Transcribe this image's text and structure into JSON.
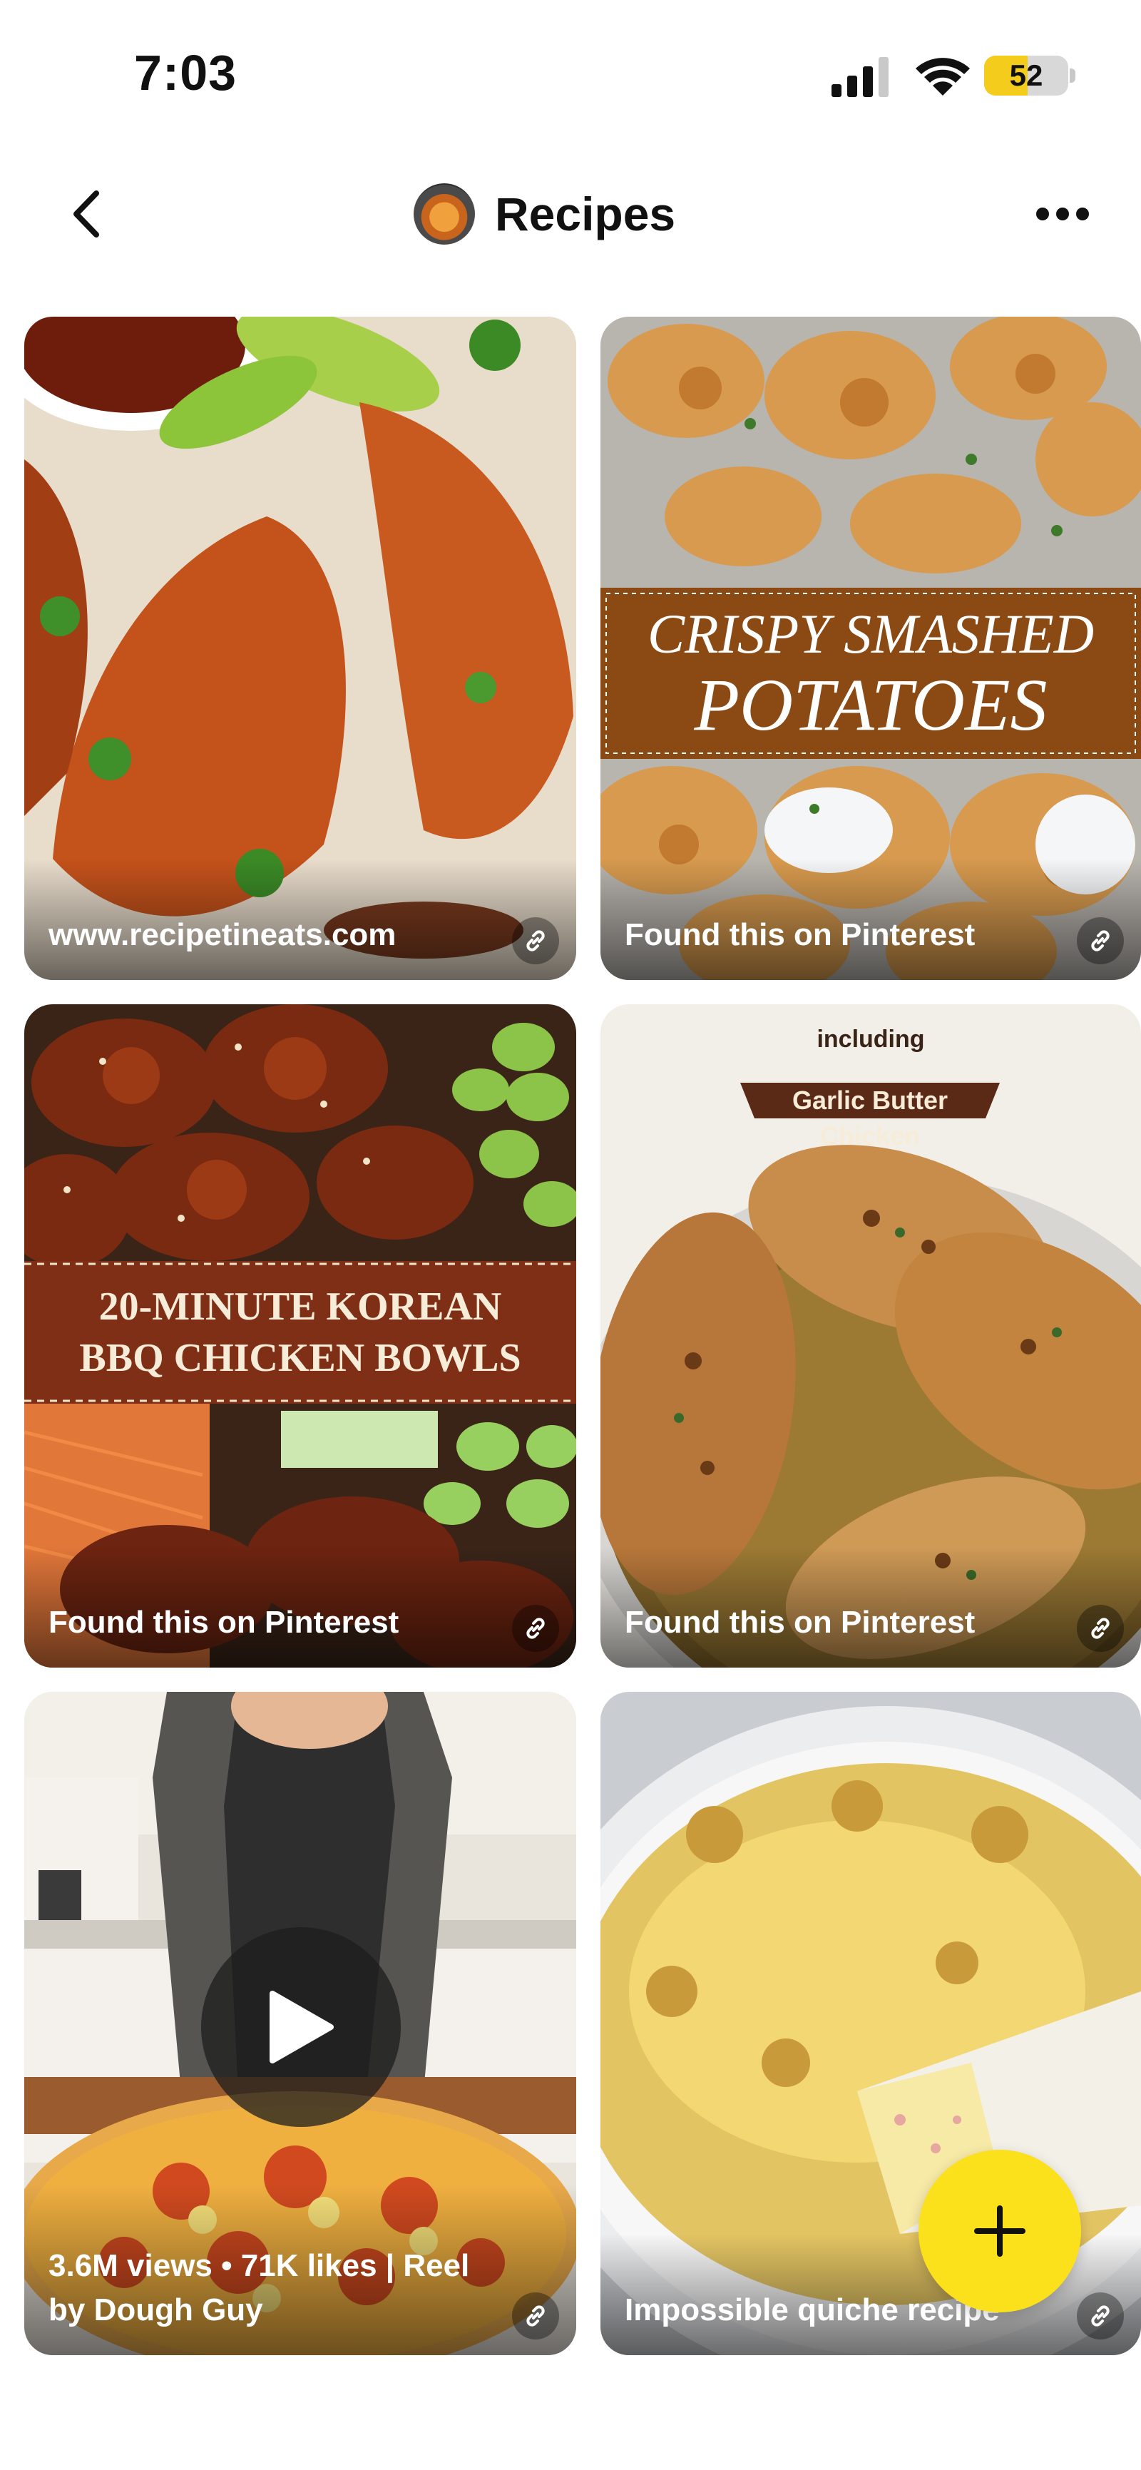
{
  "status_bar": {
    "time": "7:03",
    "battery_level": "52",
    "battery_fraction": 0.52,
    "icons": [
      "cellular-signal-icon",
      "wifi-icon",
      "battery-icon"
    ]
  },
  "header": {
    "back_icon": "chevron-left-icon",
    "title": "Recipes",
    "more_icon": "more-horizontal-icon"
  },
  "pins": [
    {
      "source": "www.recipetineats.com",
      "image": "birria tacos with lime and salsa"
    },
    {
      "source": "Found this on Pinterest",
      "image": "crispy smashed potatoes",
      "banner_line1": "CRISPY SMASHED",
      "banner_line2": "POTATOES"
    },
    {
      "source": "Found this on Pinterest",
      "image": "korean bbq chicken bowls",
      "banner_line1": "20-MINUTE KOREAN",
      "banner_line2": "BBQ CHICKEN BOWLS"
    },
    {
      "source": "Found this on Pinterest",
      "image": "garlic butter chicken in skillet",
      "banner_small": "including",
      "banner_tag": "Garlic Butter Chicken"
    },
    {
      "source": "3.6M views • 71K likes | Reel by Dough Guy",
      "image": "chef with pizza video",
      "is_video": true
    },
    {
      "source": "Impossible quiche recipe",
      "image": "impossible quiche in pie dish"
    }
  ],
  "fab": {
    "icon": "plus-icon"
  },
  "colors": {
    "accent_yellow": "#fbe01c",
    "banner_brown": "#8b4a13",
    "banner_maroon": "#7e2f16",
    "tag_brown": "#5a2a17"
  }
}
